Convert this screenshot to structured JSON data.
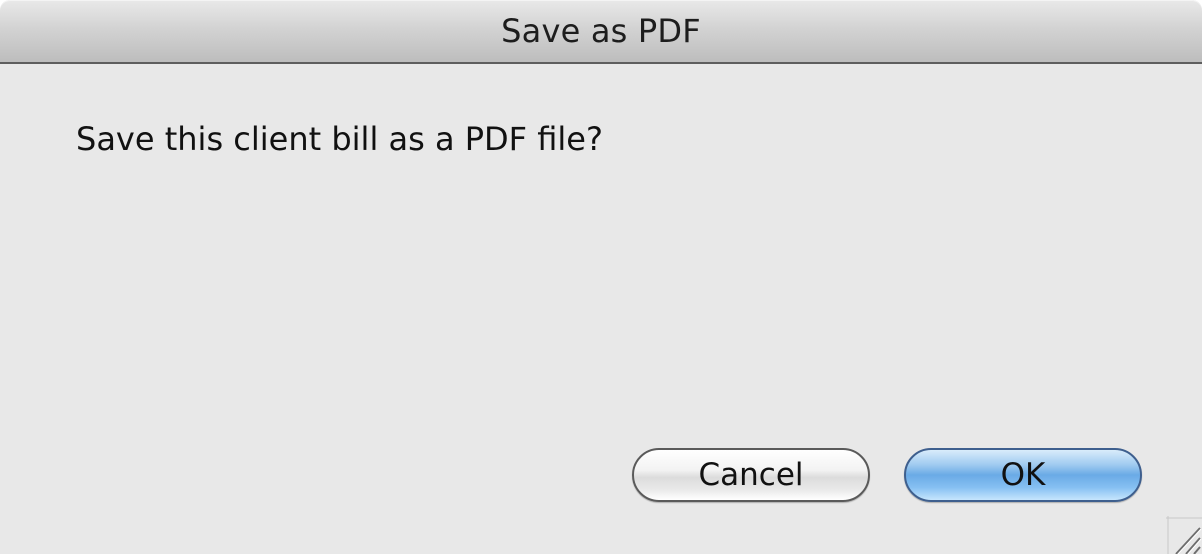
{
  "dialog": {
    "title": "Save as PDF",
    "message": "Save this client bill as a PDF file?",
    "cancel_label": "Cancel",
    "ok_label": "OK"
  },
  "icons": {
    "resize_grip": "resize-grip-icon"
  },
  "colors": {
    "dialog_background": "#e8e8e8",
    "default_button_accent": "#6aaae6"
  }
}
